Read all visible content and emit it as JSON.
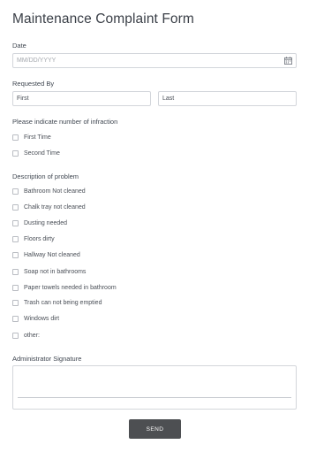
{
  "form": {
    "title": "Maintenance Complaint Form",
    "date": {
      "label": "Date",
      "placeholder": "MM/DD/YYYY",
      "icon": "calendar-icon"
    },
    "requested_by": {
      "label": "Requested By",
      "first": "First",
      "last": "Last"
    },
    "infraction": {
      "label": "Please indicate number of infraction",
      "options": [
        "First Time",
        "Second Time"
      ]
    },
    "problem": {
      "label": "Description of problem",
      "options": [
        "Bathroom Not cleaned",
        "Chalk tray not cleaned",
        "Dusting needed",
        "Floors dirty",
        "Hallway Not cleaned",
        "Soap not in bathrooms",
        "Paper towels needed in bathroom",
        "Trash can not being emptied",
        "Windows dirt",
        "other:"
      ]
    },
    "signature": {
      "label": "Administrator Signature"
    },
    "submit_label": "SEND"
  }
}
